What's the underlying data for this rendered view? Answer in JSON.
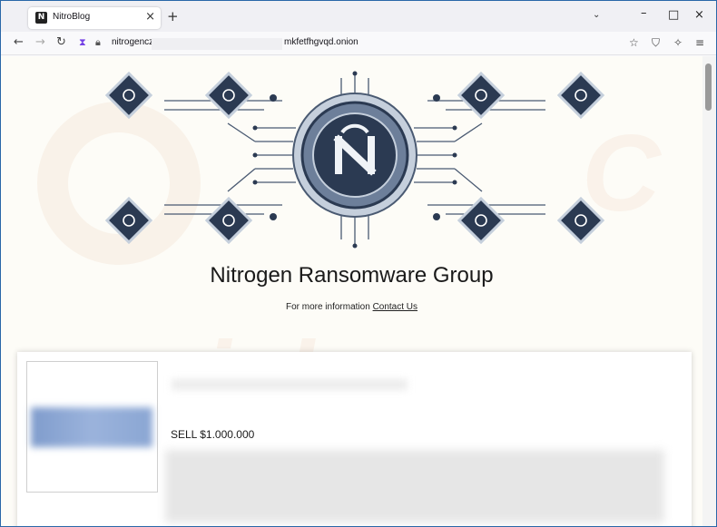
{
  "browser": {
    "tab": {
      "title": "NitroBlog",
      "favicon": "N"
    },
    "url": {
      "left": "nitrogencz",
      "right": "mkfetfhgvqd.onion"
    },
    "icons": {
      "back": "←",
      "forward": "→",
      "reload": "↻",
      "new_tab": "+",
      "list_tabs": "⌄",
      "close_tab": "×",
      "minimize": "–",
      "maximize": "□",
      "close": "×",
      "bookmark": "☆",
      "shield": "⛉",
      "extensions": "✧",
      "menu": "≡"
    }
  },
  "page": {
    "title": "Nitrogen Ransomware Group",
    "info_prefix": "For more information",
    "contact_link": "Contact Us",
    "watermark": "risk.com",
    "listing": {
      "price": "SELL $1.000.000"
    }
  },
  "colors": {
    "banner_dark": "#2b3a52",
    "banner_mid": "#6d7f9a",
    "banner_light": "#c5cfdc",
    "page_bg": "#fdfcf7"
  }
}
